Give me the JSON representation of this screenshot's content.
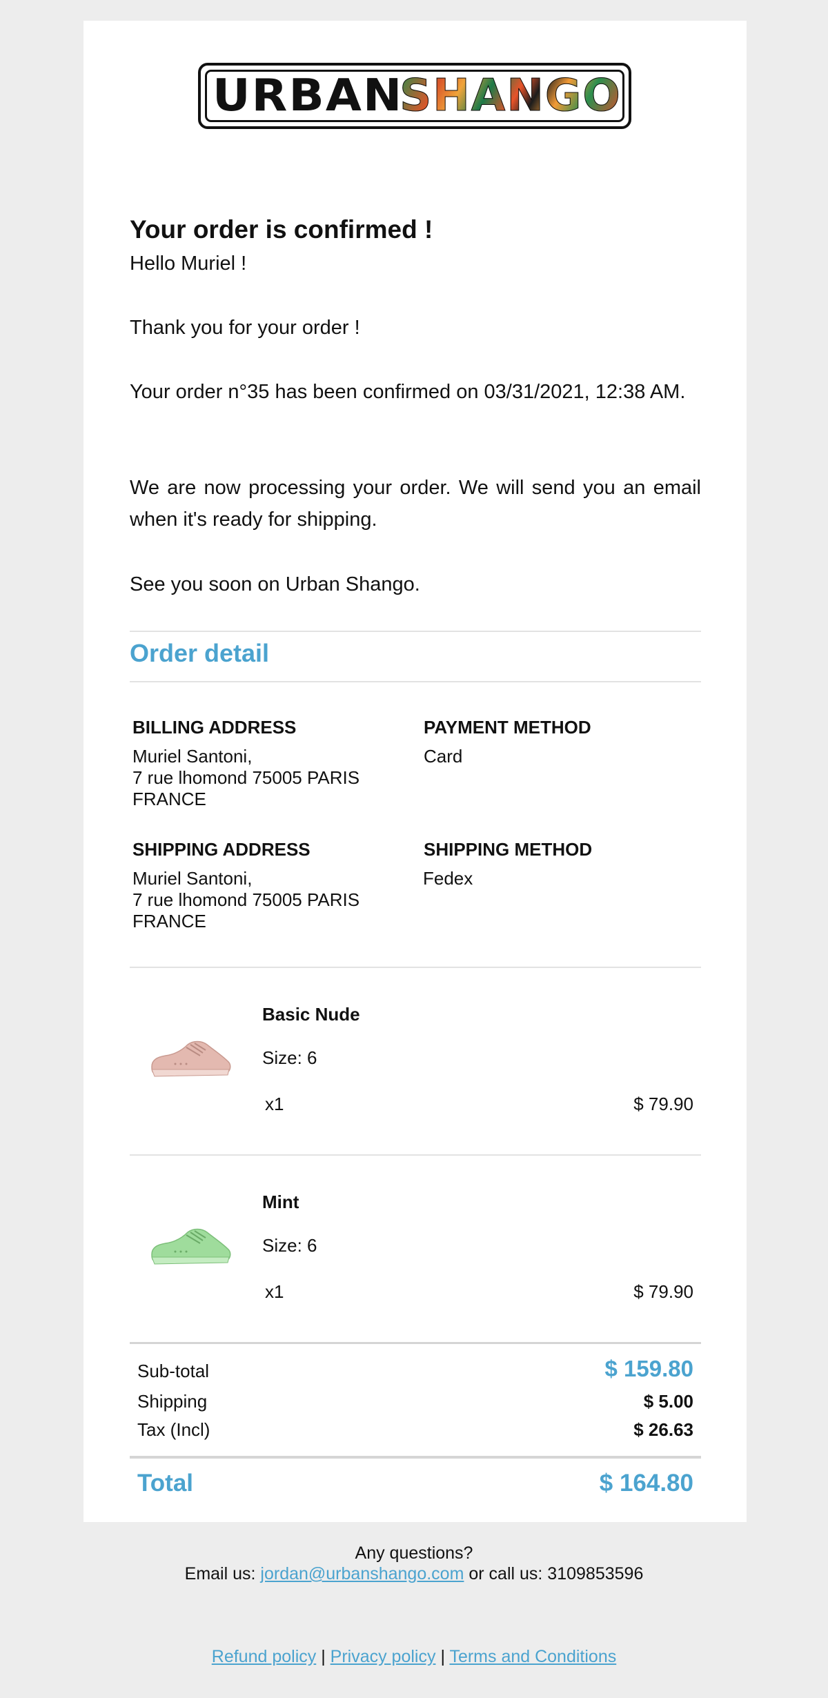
{
  "brand": {
    "logo_text_1": "URBAN",
    "logo_text_2": "SHANGO"
  },
  "header": {
    "title": "Your order is confirmed !"
  },
  "body": {
    "greeting": "Hello Muriel !",
    "thanks": "Thank you for your order !",
    "confirmation": "Your order n°35 has been confirmed on 03/31/2021, 12:38 AM.",
    "processing": "We are now processing your order. We will send you an email when it's ready for shipping.",
    "see_you": "See you soon on Urban Shango."
  },
  "order_detail": {
    "title": "Order detail",
    "billing": {
      "label": "BILLING ADDRESS",
      "name": "Muriel Santoni,",
      "street": "7 rue lhomond 75005 PARIS",
      "country": "FRANCE"
    },
    "payment": {
      "label": "PAYMENT METHOD",
      "value": "Card"
    },
    "shipping_address": {
      "label": "SHIPPING ADDRESS",
      "name": "Muriel Santoni,",
      "street": "7 rue lhomond 75005 PARIS",
      "country": "FRANCE"
    },
    "shipping_method": {
      "label": "SHIPPING METHOD",
      "value": "Fedex"
    }
  },
  "items": [
    {
      "name": "Basic Nude",
      "size": "Size: 6",
      "qty": "x1",
      "price": "$ 79.90",
      "color": "#e3b9b0"
    },
    {
      "name": "Mint",
      "size": "Size: 6",
      "qty": "x1",
      "price": "$ 79.90",
      "color": "#9fdc9c"
    }
  ],
  "summary": {
    "subtotal_label": "Sub-total",
    "subtotal": "$ 159.80",
    "shipping_label": "Shipping",
    "shipping": "$ 5.00",
    "tax_label": "Tax (Incl)",
    "tax": "$ 26.63",
    "total_label": "Total",
    "total": "$ 164.80"
  },
  "footer": {
    "questions": "Any questions?",
    "email_prefix": "Email us:",
    "email": "jordan@urbanshango.com",
    "call_text": "or call us: 3109853596",
    "links": [
      "Refund policy",
      "Privacy policy",
      "Terms and Conditions"
    ],
    "separator": "|"
  },
  "colors": {
    "accent": "#4ba3cf",
    "background": "#ededed"
  }
}
